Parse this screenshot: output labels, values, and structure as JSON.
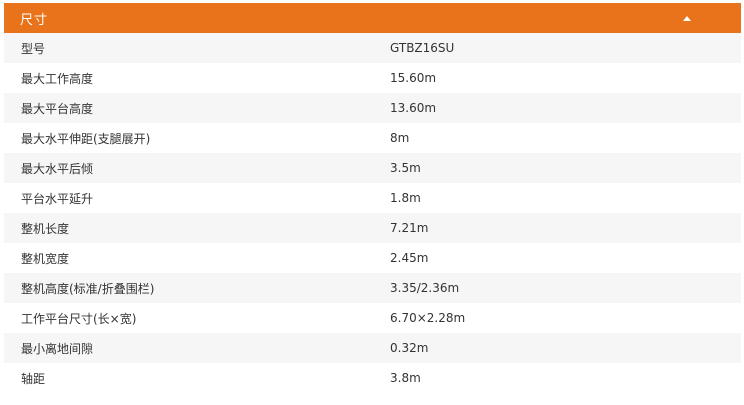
{
  "section": {
    "title": "尺寸",
    "toggle_icon": "caret-up-icon",
    "accent_color": "#e8731b"
  },
  "specs": [
    {
      "label": "型号",
      "value": "GTBZ16SU"
    },
    {
      "label": "最大工作高度",
      "value": "15.60m"
    },
    {
      "label": "最大平台高度",
      "value": "13.60m"
    },
    {
      "label": "最大水平伸距(支腿展开)",
      "value": "8m"
    },
    {
      "label": "最大水平后倾",
      "value": "3.5m"
    },
    {
      "label": "平台水平延升",
      "value": "1.8m"
    },
    {
      "label": "整机长度",
      "value": "7.21m"
    },
    {
      "label": "整机宽度",
      "value": "2.45m"
    },
    {
      "label": "整机高度(标准/折叠围栏)",
      "value": "3.35/2.36m"
    },
    {
      "label": "工作平台尺寸(长×宽)",
      "value": "6.70×2.28m"
    },
    {
      "label": "最小离地间隙",
      "value": "0.32m"
    },
    {
      "label": "轴距",
      "value": "3.8m"
    }
  ]
}
